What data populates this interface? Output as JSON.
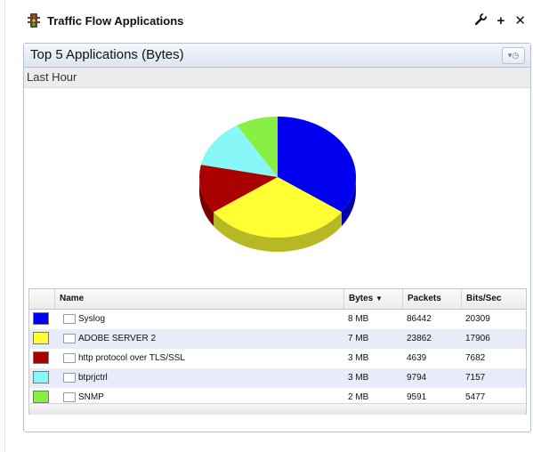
{
  "dashlet": {
    "title": "Traffic Flow Applications",
    "icon": "traffic-light-icon",
    "tools": {
      "settings": "wrench-icon",
      "add": "plus-icon",
      "close": "close-icon"
    }
  },
  "panel": {
    "title": "Top 5 Applications (Bytes)",
    "time_button_icon": "clock-icon",
    "subheader": "Last Hour"
  },
  "table": {
    "columns": {
      "name": "Name",
      "bytes": "Bytes",
      "packets": "Packets",
      "bits_sec": "Bits/Sec"
    },
    "sort_icon": "sort-down-icon",
    "rows": [
      {
        "color": "#0000ee",
        "name": "Syslog",
        "bytes": "8 MB",
        "packets": "86442",
        "bits_sec": "20309"
      },
      {
        "color": "#ffff33",
        "name": "ADOBE SERVER 2",
        "bytes": "7 MB",
        "packets": "23862",
        "bits_sec": "17906"
      },
      {
        "color": "#aa0000",
        "name": "http protocol over TLS/SSL",
        "bytes": "3 MB",
        "packets": "4639",
        "bits_sec": "7682"
      },
      {
        "color": "#88f7f7",
        "name": "btprjctrl",
        "bytes": "3 MB",
        "packets": "9794",
        "bits_sec": "7157"
      },
      {
        "color": "#88f044",
        "name": "SNMP",
        "bytes": "2 MB",
        "packets": "9591",
        "bits_sec": "5477"
      }
    ]
  },
  "chart_data": {
    "type": "pie",
    "categories": [
      "Syslog",
      "ADOBE SERVER 2",
      "http protocol over TLS/SSL",
      "btprjctrl",
      "SNMP"
    ],
    "values": [
      8,
      7,
      3,
      3,
      2
    ],
    "colors": [
      "#0000ee",
      "#ffff33",
      "#aa0000",
      "#88f7f7",
      "#88f044"
    ]
  }
}
